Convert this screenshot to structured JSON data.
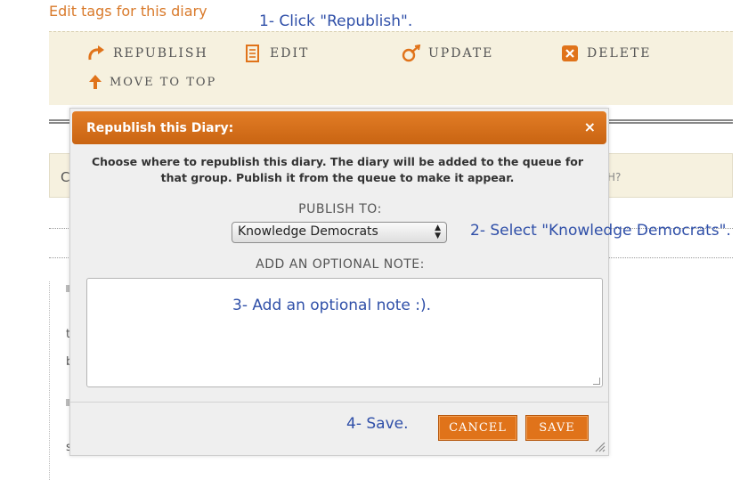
{
  "page": {
    "edit_tags_link": "Edit tags for this diary",
    "bg_fragment_c": "C",
    "bg_fragment_h": "H?",
    "bg_fragment_t": "t",
    "bg_fragment_b": "b",
    "bg_fragment_s": "s"
  },
  "annotations": {
    "step1": "1- Click \"Republish\".",
    "step2": "2- Select \"Knowledge Democrats\".",
    "step3": "3- Add an optional note :).",
    "step4": "4- Save."
  },
  "toolbar": {
    "items": [
      {
        "label": "REPUBLISH",
        "icon": "republish-arrow-icon"
      },
      {
        "label": "EDIT",
        "icon": "edit-document-icon"
      },
      {
        "label": "UPDATE",
        "icon": "update-icon"
      },
      {
        "label": "DELETE",
        "icon": "delete-icon"
      },
      {
        "label": "MOVE TO TOP",
        "icon": "arrow-up-icon"
      }
    ],
    "icon_color": "#e0731a"
  },
  "dialog": {
    "title": "Republish this Diary:",
    "close_symbol": "×",
    "description": "Choose where to republish this diary. The diary will be added to the queue for that group. Publish it from the queue to make it appear.",
    "publish_to_label": "PUBLISH TO:",
    "publish_to_selected": "Knowledge Democrats",
    "note_label": "ADD AN OPTIONAL NOTE:",
    "note_value": "",
    "cancel_label": "CANCEL",
    "save_label": "SAVE",
    "header_color": "#d9711c",
    "button_color": "#e0731a"
  }
}
